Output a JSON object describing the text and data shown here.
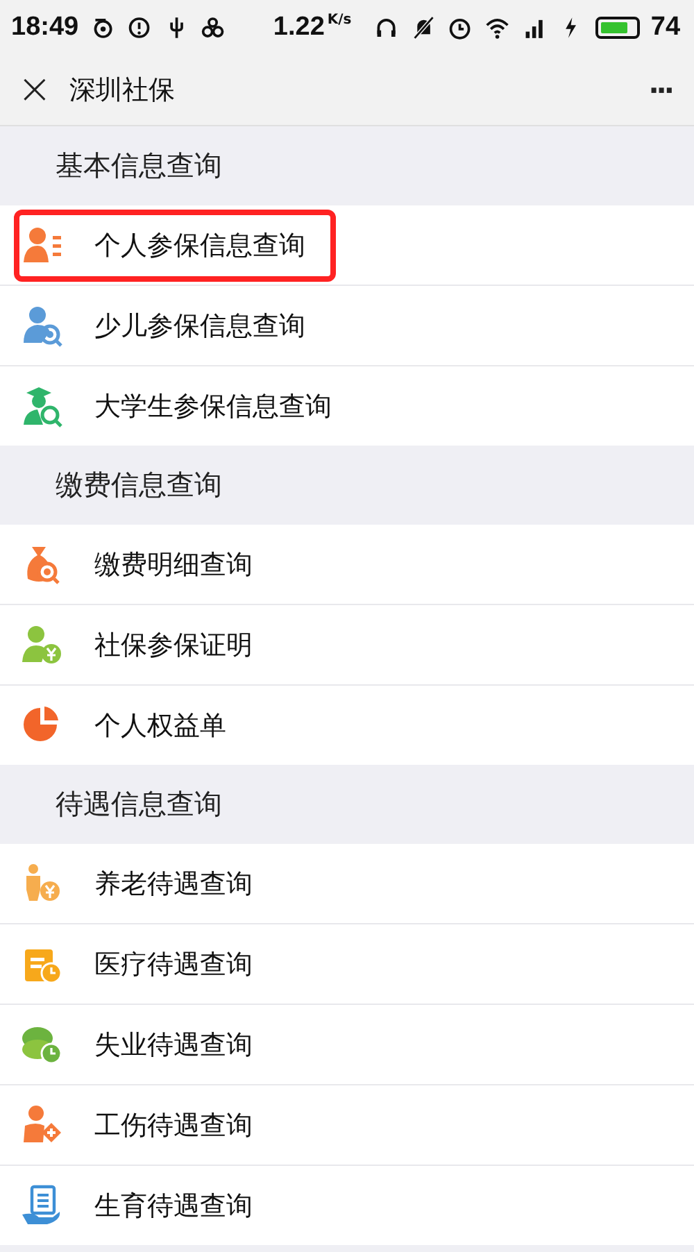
{
  "status_bar": {
    "time": "18:49",
    "speed": "1.22",
    "speed_unit": "K/s",
    "battery": "74"
  },
  "nav_bar": {
    "close": "×",
    "title": "深圳社保",
    "more": "···"
  },
  "sections": [
    {
      "title": "基本信息查询",
      "items": [
        {
          "label": "个人参保信息查询",
          "highlighted": true
        },
        {
          "label": "少儿参保信息查询",
          "highlighted": false
        },
        {
          "label": "大学生参保信息查询",
          "highlighted": false
        }
      ]
    },
    {
      "title": "缴费信息查询",
      "items": [
        {
          "label": "缴费明细查询",
          "highlighted": false
        },
        {
          "label": "社保参保证明",
          "highlighted": false
        },
        {
          "label": "个人权益单",
          "highlighted": false
        }
      ]
    },
    {
      "title": "待遇信息查询",
      "items": [
        {
          "label": "养老待遇查询",
          "highlighted": false
        },
        {
          "label": "医疗待遇查询",
          "highlighted": false
        },
        {
          "label": "失业待遇查询",
          "highlighted": false
        },
        {
          "label": "工伤待遇查询",
          "highlighted": false
        },
        {
          "label": "生育待遇查询",
          "highlighted": false
        }
      ]
    }
  ]
}
